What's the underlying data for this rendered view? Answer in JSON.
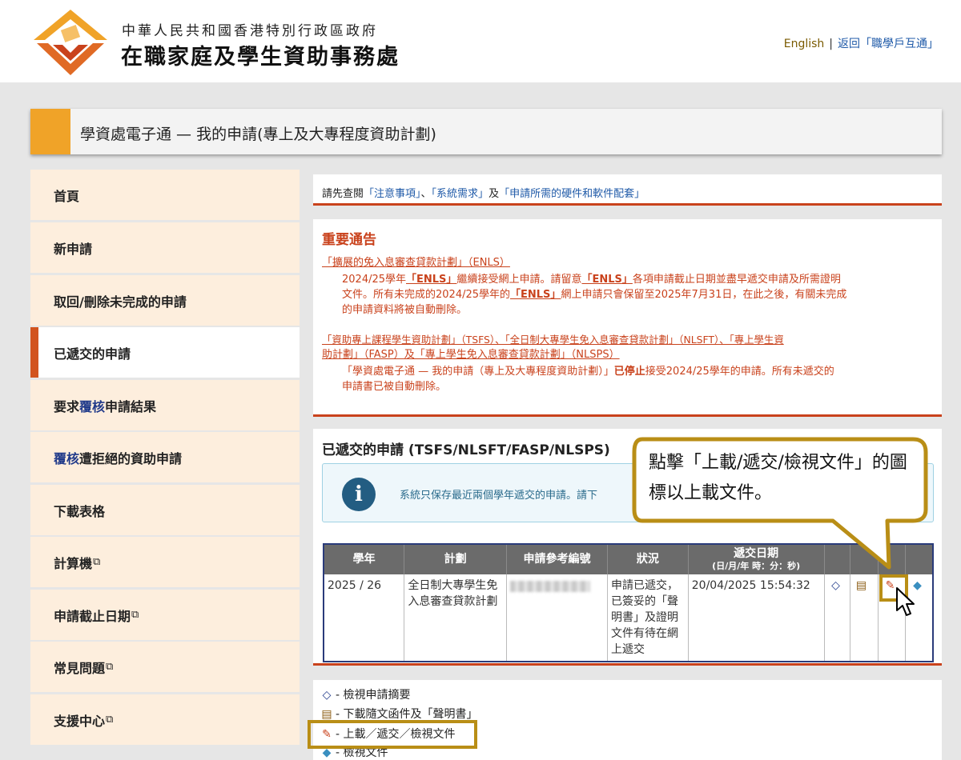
{
  "header": {
    "org_line1": "中華人民共和國香港特別行政區政府",
    "org_line2": "在職家庭及學生資助事務處",
    "lang_link": "English",
    "separator": "|",
    "back_link": "返回「職學戶互通」"
  },
  "title": {
    "page_title": "學資處電子通 — 我的申請(專上及大專程度資助計劃)"
  },
  "sidebar": {
    "items": [
      {
        "label": "首頁"
      },
      {
        "label": "新申請"
      },
      {
        "label": "取回/刪除未完成的申請"
      },
      {
        "label": "已遞交的申請"
      },
      {
        "label_pre": "要求",
        "label_hl": "覆核",
        "label_post": "申請結果"
      },
      {
        "label_hl": "覆核",
        "label_post": "遭拒絕的資助申請"
      },
      {
        "label": "下載表格"
      },
      {
        "label": "計算機"
      },
      {
        "label": "申請截止日期"
      },
      {
        "label": "常見問題"
      },
      {
        "label": "支援中心"
      }
    ],
    "external_icon": "⧉"
  },
  "pre_notice": {
    "text1": "請先查閱",
    "link1": "「注意事項」",
    "text2": "、",
    "link2": "「系統需求」",
    "text3": "及",
    "link3": "「申請所需的硬件和軟件配套」"
  },
  "notice": {
    "title": "重要通告",
    "s1_heading": "「擴展的免入息審查貸款計劃」（ENLS）",
    "s1_l1_a": "2024/25學年",
    "s1_l1_b": "「ENLS」",
    "s1_l1_c": "繼續接受網上申請。請留意",
    "s1_l1_d": "「ENLS」",
    "s1_l1_e": "各項申請截止日期並盡早遞交申請及所需證明",
    "s1_l2": "文件。所有未完成的2024/25學年的",
    "s1_l2_b": "「ENLS」",
    "s1_l2_c": "網上申請只會保留至2025年7月31日，在此之後，有關未完成",
    "s1_l3": "的申請資料將被自動刪除。",
    "s2_h1": "「資助專上課程學生資助計劃」（TSFS）、「全日制大專學生免入息審查貸款計劃」（NLSFT）、「專上學生資",
    "s2_h2": "助計劃」（FASP）及「專上學生免入息審查貸款計劃」（NLSPS）",
    "s2_l1_a": "「學資處電子通 — 我的申請（專上及大專程度資助計劃）」",
    "s2_l1_b": "已停止",
    "s2_l1_c": "接受2024/25學年的申請。所有未遞交的",
    "s2_l2": "申請書已被自動刪除。"
  },
  "submitted": {
    "title": "已遞交的申請 (TSFS/NLSFT/FASP/NLSPS)",
    "info_icon": "i",
    "info_text": "系統只保存最近兩個學年遞交的申請。請下",
    "headers": {
      "year": "學年",
      "scheme": "計劃",
      "ref": "申請參考編號",
      "status": "狀況",
      "date": "遞交日期",
      "date_sub": "(日/月/年 時：分：秒)"
    },
    "row": {
      "year": "2025 / 26",
      "scheme": "全日制大專學生免入息審查貸款計劃",
      "status": "申請已遞交，已簽妥的「聲明書」及證明文件有待在網上遞交",
      "date": "20/04/2025 15:54:32"
    }
  },
  "icons": {
    "summary": "summary-icon",
    "docs": "document-download-icon",
    "upload": "upload-icon",
    "view": "view-documents-icon"
  },
  "callout": {
    "text": "點擊「上載/遞交/檢視文件」的圖標以上載文件。"
  },
  "legend": {
    "summary": "- 檢視申請摘要",
    "docs": "- 下載隨文函件及「聲明書」",
    "upload": "- 上載／遞交／檢視文件",
    "view": "- 檢視文件"
  },
  "colors": {
    "accent_orange": "#f0a328",
    "notice_red": "#c9421c",
    "sidebar_bg": "#fdeedd",
    "callout_gold": "#b98e16",
    "link_blue": "#1f5aa8"
  }
}
